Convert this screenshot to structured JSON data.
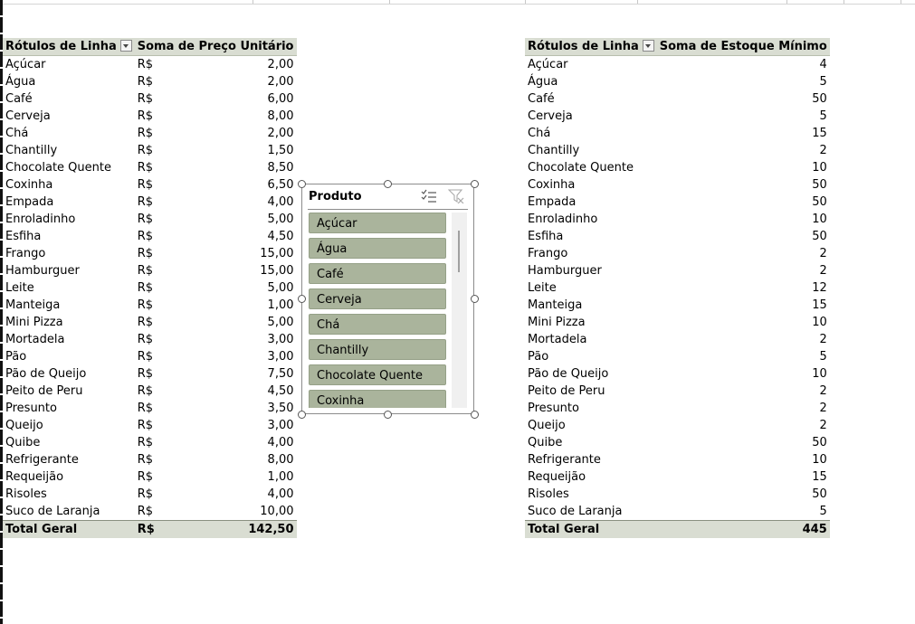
{
  "pivot_left": {
    "header_rows": "Rótulos de Linha",
    "header_value": "Soma de Preço Unitário",
    "rows": [
      {
        "label": "Açúcar",
        "currency": "R$",
        "value": "2,00"
      },
      {
        "label": "Água",
        "currency": "R$",
        "value": "2,00"
      },
      {
        "label": "Café",
        "currency": "R$",
        "value": "6,00"
      },
      {
        "label": "Cerveja",
        "currency": "R$",
        "value": "8,00"
      },
      {
        "label": "Chá",
        "currency": "R$",
        "value": "2,00"
      },
      {
        "label": "Chantilly",
        "currency": "R$",
        "value": "1,50"
      },
      {
        "label": "Chocolate Quente",
        "currency": "R$",
        "value": "8,50"
      },
      {
        "label": "Coxinha",
        "currency": "R$",
        "value": "6,50"
      },
      {
        "label": "Empada",
        "currency": "R$",
        "value": "4,00"
      },
      {
        "label": "Enroladinho",
        "currency": "R$",
        "value": "5,00"
      },
      {
        "label": "Esfiha",
        "currency": "R$",
        "value": "4,50"
      },
      {
        "label": "Frango",
        "currency": "R$",
        "value": "15,00"
      },
      {
        "label": "Hamburguer",
        "currency": "R$",
        "value": "15,00"
      },
      {
        "label": "Leite",
        "currency": "R$",
        "value": "5,00"
      },
      {
        "label": "Manteiga",
        "currency": "R$",
        "value": "1,00"
      },
      {
        "label": "Mini Pizza",
        "currency": "R$",
        "value": "5,00"
      },
      {
        "label": "Mortadela",
        "currency": "R$",
        "value": "3,00"
      },
      {
        "label": "Pão",
        "currency": "R$",
        "value": "3,00"
      },
      {
        "label": "Pão de Queijo",
        "currency": "R$",
        "value": "7,50"
      },
      {
        "label": "Peito de Peru",
        "currency": "R$",
        "value": "4,50"
      },
      {
        "label": "Presunto",
        "currency": "R$",
        "value": "3,50"
      },
      {
        "label": "Queijo",
        "currency": "R$",
        "value": "3,00"
      },
      {
        "label": "Quibe",
        "currency": "R$",
        "value": "4,00"
      },
      {
        "label": "Refrigerante",
        "currency": "R$",
        "value": "8,00"
      },
      {
        "label": "Requeijão",
        "currency": "R$",
        "value": "1,00"
      },
      {
        "label": "Risoles",
        "currency": "R$",
        "value": "4,00"
      },
      {
        "label": "Suco de Laranja",
        "currency": "R$",
        "value": "10,00"
      }
    ],
    "total_label": "Total Geral",
    "total_currency": "R$",
    "total_value": "142,50"
  },
  "pivot_right": {
    "header_rows": "Rótulos de Linha",
    "header_value": "Soma de Estoque Mínimo",
    "rows": [
      {
        "label": "Açúcar",
        "value": "4"
      },
      {
        "label": "Água",
        "value": "5"
      },
      {
        "label": "Café",
        "value": "50"
      },
      {
        "label": "Cerveja",
        "value": "5"
      },
      {
        "label": "Chá",
        "value": "15"
      },
      {
        "label": "Chantilly",
        "value": "2"
      },
      {
        "label": "Chocolate Quente",
        "value": "10"
      },
      {
        "label": "Coxinha",
        "value": "50"
      },
      {
        "label": "Empada",
        "value": "50"
      },
      {
        "label": "Enroladinho",
        "value": "10"
      },
      {
        "label": "Esfiha",
        "value": "50"
      },
      {
        "label": "Frango",
        "value": "2"
      },
      {
        "label": "Hamburguer",
        "value": "2"
      },
      {
        "label": "Leite",
        "value": "12"
      },
      {
        "label": "Manteiga",
        "value": "15"
      },
      {
        "label": "Mini Pizza",
        "value": "10"
      },
      {
        "label": "Mortadela",
        "value": "2"
      },
      {
        "label": "Pão",
        "value": "5"
      },
      {
        "label": "Pão de Queijo",
        "value": "10"
      },
      {
        "label": "Peito de Peru",
        "value": "2"
      },
      {
        "label": "Presunto",
        "value": "2"
      },
      {
        "label": "Queijo",
        "value": "2"
      },
      {
        "label": "Quibe",
        "value": "50"
      },
      {
        "label": "Refrigerante",
        "value": "10"
      },
      {
        "label": "Requeijão",
        "value": "15"
      },
      {
        "label": "Risoles",
        "value": "50"
      },
      {
        "label": "Suco de Laranja",
        "value": "5"
      }
    ],
    "total_label": "Total Geral",
    "total_value": "445"
  },
  "slicer": {
    "title": "Produto",
    "items": [
      "Açúcar",
      "Água",
      "Café",
      "Cerveja",
      "Chá",
      "Chantilly",
      "Chocolate Quente",
      "Coxinha"
    ],
    "multiselect_icon": "multi-select-icon",
    "clear_filter_icon": "clear-filter-icon"
  },
  "colors": {
    "pivot_header_bg": "#d9ddd2",
    "slicer_item_bg": "#aab49c"
  }
}
